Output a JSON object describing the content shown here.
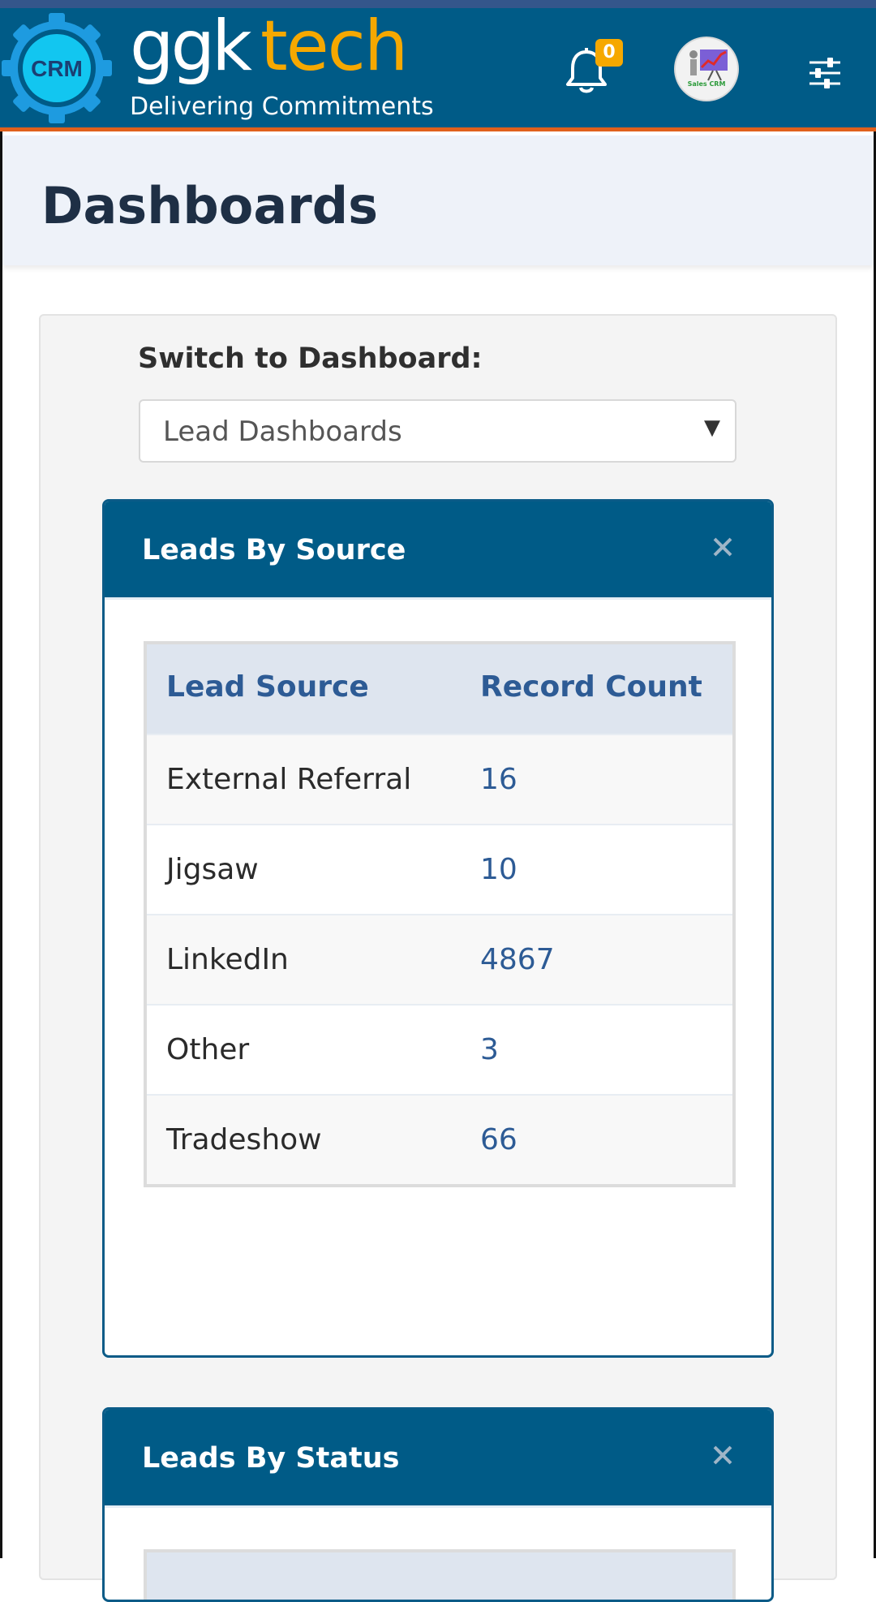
{
  "header": {
    "gear_logo_text": "CRM",
    "brand_ggk": "ggk",
    "brand_tech": "tech",
    "tagline": "Delivering Commitments",
    "notification_count": "0",
    "avatar_label": "Sales CRM",
    "colors": {
      "bar": "#005b87",
      "accent": "#f6a800",
      "underline": "#e0601c"
    },
    "icons": [
      "gear-logo-icon",
      "bell-icon",
      "avatar-icon",
      "settings-sliders-icon"
    ]
  },
  "page": {
    "title": "Dashboards"
  },
  "switcher": {
    "label": "Switch to Dashboard:",
    "selected": "Lead Dashboards"
  },
  "cards": [
    {
      "title": "Leads By Source",
      "columns": [
        "Lead Source",
        "Record Count"
      ],
      "rows": [
        [
          "External Referral",
          "16"
        ],
        [
          "Jigsaw",
          "10"
        ],
        [
          "LinkedIn",
          "4867"
        ],
        [
          "Other",
          "3"
        ],
        [
          "Tradeshow",
          "66"
        ]
      ]
    },
    {
      "title": "Leads By Status"
    }
  ]
}
